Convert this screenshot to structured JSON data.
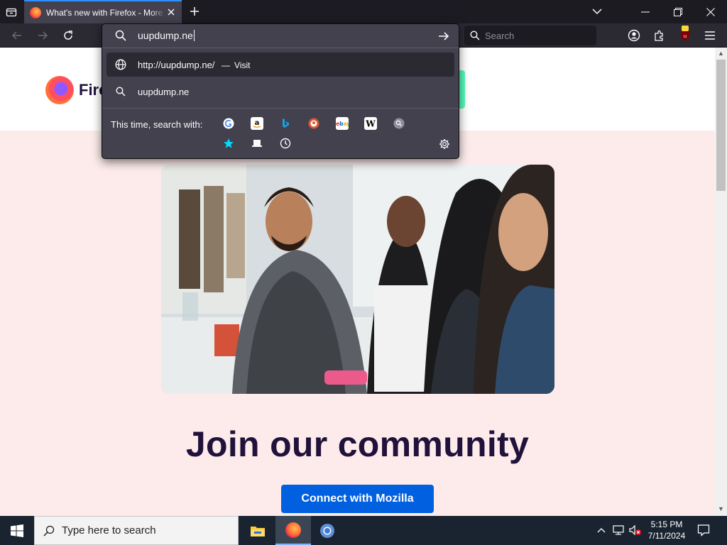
{
  "browser": {
    "tab": {
      "title": "What's new with Firefox - More"
    },
    "searchbar": {
      "placeholder": "Search"
    },
    "urlbar": {
      "input_value": "uupdump.ne",
      "results": [
        {
          "text": "http://uupdump.ne/",
          "separator": "—",
          "action": "Visit",
          "icon": "globe-icon"
        },
        {
          "text": "uupdump.ne",
          "icon": "search-icon"
        }
      ],
      "oneoff_label": "This time, search with:",
      "engines": [
        "Google",
        "Amazon",
        "Bing",
        "DuckDuckGo",
        "eBay",
        "Wikipedia",
        "Search",
        "Bookmarks",
        "Tabs",
        "History"
      ]
    }
  },
  "page": {
    "wordmark": "Fire",
    "headline": "Join our community",
    "cta_label": "Connect with Mozilla"
  },
  "taskbar": {
    "search_placeholder": "Type here to search",
    "time": "5:15 PM",
    "date": "7/11/2024"
  },
  "colors": {
    "accent": "#2f90ff",
    "page_bg": "#fdebeb",
    "headline": "#20123a",
    "cta": "#0060df"
  }
}
